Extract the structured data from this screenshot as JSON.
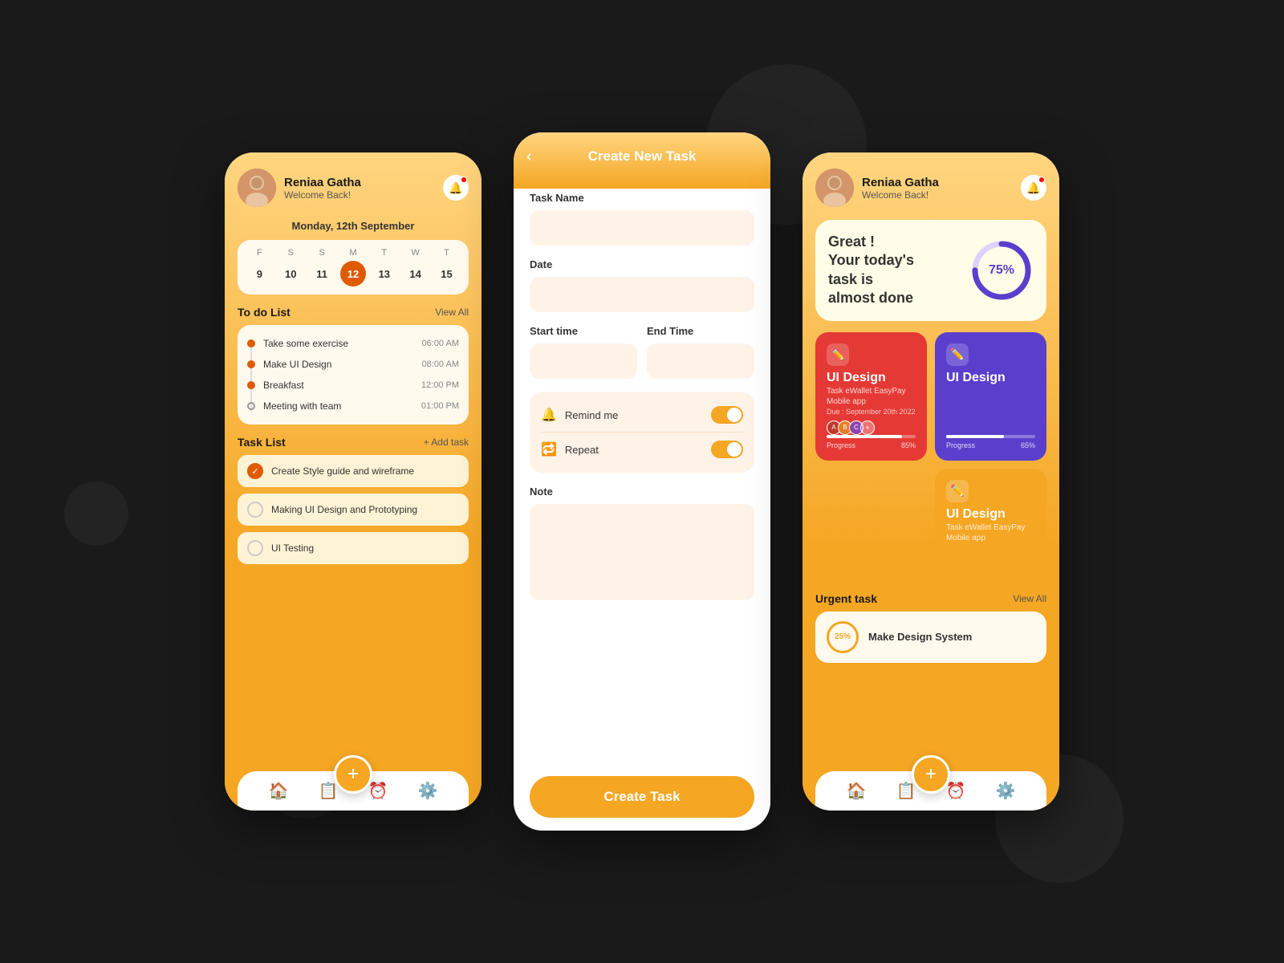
{
  "background": "#1a1a1a",
  "phone1": {
    "user": {
      "name": "Reniaa Gatha",
      "subtitle": "Welcome Back!"
    },
    "date_label": "Monday, 12th September",
    "calendar": {
      "days": [
        "F",
        "S",
        "S",
        "M",
        "T",
        "W",
        "T"
      ],
      "dates": [
        "9",
        "10",
        "11",
        "12",
        "13",
        "14",
        "15"
      ],
      "active_index": 3
    },
    "todo": {
      "title": "To do List",
      "view_all": "View All",
      "items": [
        {
          "name": "Take some exercise",
          "time": "06:00 AM",
          "done": true
        },
        {
          "name": "Make UI Design",
          "time": "08:00 AM",
          "done": true
        },
        {
          "name": "Breakfast",
          "time": "12:00 PM",
          "done": true
        },
        {
          "name": "Meeting with team",
          "time": "01:00 PM",
          "done": false
        }
      ]
    },
    "tasks": {
      "title": "Task List",
      "add_label": "+ Add task",
      "items": [
        {
          "label": "Create Style guide and wireframe",
          "checked": true
        },
        {
          "label": "Making UI Design and Prototyping",
          "checked": false
        },
        {
          "label": "UI Testing",
          "checked": false
        }
      ]
    },
    "nav": {
      "home": "🏠",
      "tasks": "📋",
      "clock": "⏰",
      "settings": "⚙️",
      "plus": "+"
    }
  },
  "phone2": {
    "header": {
      "back": "‹",
      "title": "Create New Task"
    },
    "form": {
      "task_name_label": "Task Name",
      "task_name_placeholder": "",
      "date_label": "Date",
      "date_placeholder": "",
      "start_time_label": "Start time",
      "start_time_placeholder": "",
      "end_time_label": "End Time",
      "end_time_placeholder": "",
      "remind_label": "Remind me",
      "repeat_label": "Repeat",
      "note_label": "Note",
      "note_placeholder": ""
    },
    "create_button": "Create Task"
  },
  "phone3": {
    "user": {
      "name": "Reniaa Gatha",
      "subtitle": "Welcome Back!"
    },
    "progress": {
      "title": "Great !",
      "subtitle": "Your today's task is almost done",
      "percent": "75%",
      "value": 75
    },
    "task_cards": [
      {
        "color": "red",
        "title": "UI Design",
        "subtitle": "Task eWallet EasyPay",
        "extra": "Mobile app",
        "date": "Due : September 20th 2022",
        "progress": 85,
        "progress_label": "85%",
        "avatars": 3
      },
      {
        "color": "purple",
        "title": "UI Design",
        "subtitle": "",
        "extra": "",
        "date": "",
        "progress": 65,
        "progress_label": "65%",
        "avatars": 0
      },
      {
        "color": "yellow",
        "title": "UI Design",
        "subtitle": "Task eWallet EasyPay",
        "extra": "Mobile app",
        "date": "",
        "progress": 0,
        "progress_label": "",
        "avatars": 0
      }
    ],
    "urgent": {
      "title": "Urgent task",
      "view_all": "View All",
      "item": {
        "percent": "25%",
        "label": "Make Design System"
      }
    },
    "nav": {
      "home": "🏠",
      "tasks": "📋",
      "clock": "⏰",
      "settings": "⚙️",
      "plus": "+"
    }
  }
}
